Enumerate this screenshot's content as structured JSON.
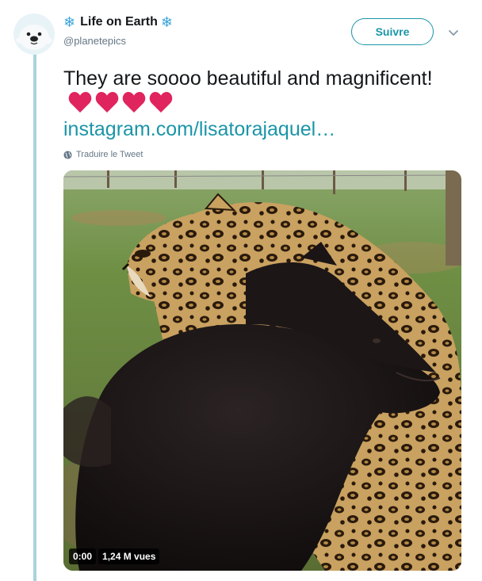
{
  "author": {
    "name": "Life on Earth",
    "handle": "@planetepics"
  },
  "follow_button": {
    "label": "Suivre"
  },
  "tweet": {
    "text": "They are soooo beautiful and magnificent!",
    "heart_count": 4,
    "link_text": "instagram.com/lisatorajaquel…",
    "translate_label": "Traduire le Tweet"
  },
  "video": {
    "time": "0:00",
    "views": "1,24 M vues"
  },
  "colors": {
    "accent": "#1b95a8",
    "thread_line": "#a8d4dc",
    "heart": "#e0245e",
    "snowflake": "#3aa3d8"
  },
  "icons": {
    "name_prefix": "snowflake-icon",
    "name_suffix": "snowflake-icon",
    "menu": "chevron-down-icon",
    "translate": "globe-icon"
  }
}
